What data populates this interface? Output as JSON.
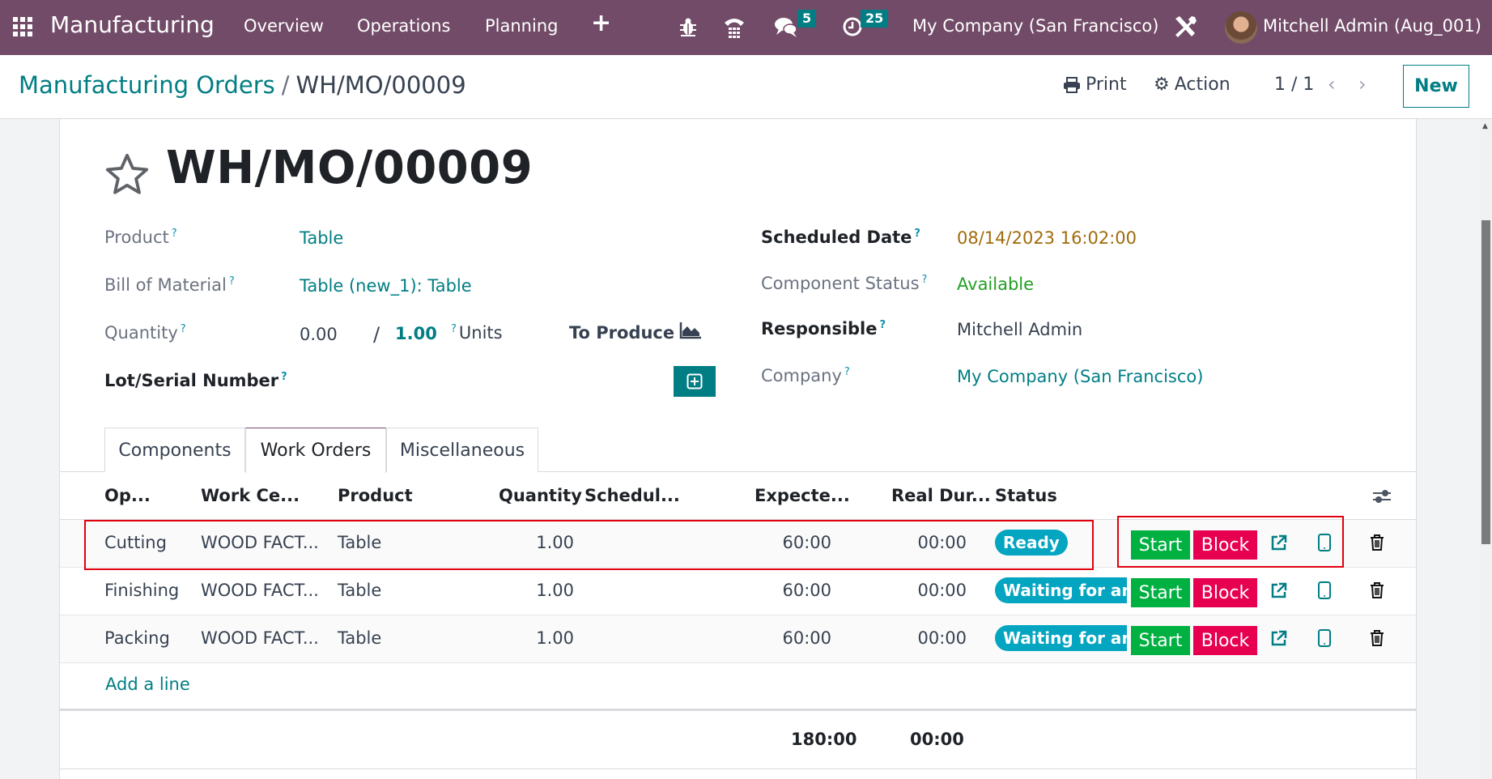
{
  "navbar": {
    "app_name": "Manufacturing",
    "menu": [
      "Overview",
      "Operations",
      "Planning"
    ],
    "messages_badge": "5",
    "activities_badge": "25",
    "company": "My Company (San Francisco)",
    "user": "Mitchell Admin (Aug_001)"
  },
  "control_panel": {
    "breadcrumb_parent": "Manufacturing Orders",
    "breadcrumb_sep": "/",
    "breadcrumb_current": "WH/MO/00009",
    "print_label": "Print",
    "action_label": "Action",
    "pager": "1 / 1",
    "new_label": "New"
  },
  "record": {
    "title": "WH/MO/00009",
    "fields_left": {
      "product_label": "Product",
      "product_value": "Table",
      "bom_label": "Bill of Material",
      "bom_value": "Table (new_1): Table",
      "quantity_label": "Quantity",
      "quantity_produced": "0.00",
      "quantity_sep": "/",
      "quantity_total": "1.00",
      "quantity_uom": "Units",
      "to_produce_label": "To Produce",
      "lot_label": "Lot/Serial Number"
    },
    "fields_right": {
      "scheduled_date_label": "Scheduled Date",
      "scheduled_date_value": "08/14/2023 16:02:00",
      "component_status_label": "Component Status",
      "component_status_value": "Available",
      "responsible_label": "Responsible",
      "responsible_value": "Mitchell Admin",
      "company_label": "Company",
      "company_value": "My Company (San Francisco)"
    },
    "help_mark": "?"
  },
  "tabs": [
    {
      "label": "Components",
      "active": false
    },
    {
      "label": "Work Orders",
      "active": true
    },
    {
      "label": "Miscellaneous",
      "active": false
    }
  ],
  "work_orders": {
    "columns": [
      "Op...",
      "Work Ce...",
      "Product",
      "Quantity",
      "Schedul...",
      "Expecte...",
      "Real Dur...",
      "Status"
    ],
    "rows": [
      {
        "operation": "Cutting",
        "work_center": "WOOD FACT...",
        "product": "Table",
        "quantity": "1.00",
        "scheduled": "",
        "expected": "60:00",
        "real": "00:00",
        "status": "Ready",
        "start_label": "Start",
        "block_label": "Block"
      },
      {
        "operation": "Finishing",
        "work_center": "WOOD FACT...",
        "product": "Table",
        "quantity": "1.00",
        "scheduled": "",
        "expected": "60:00",
        "real": "00:00",
        "status": "Waiting for another WO",
        "start_label": "Start",
        "block_label": "Block"
      },
      {
        "operation": "Packing",
        "work_center": "WOOD FACT...",
        "product": "Table",
        "quantity": "1.00",
        "scheduled": "",
        "expected": "60:00",
        "real": "00:00",
        "status": "Waiting for another WO",
        "start_label": "Start",
        "block_label": "Block"
      }
    ],
    "add_line_label": "Add a line",
    "total_expected": "180:00",
    "total_real": "00:00"
  },
  "colors": {
    "brand": "#714b67",
    "accent": "#017e84",
    "start": "#00b142",
    "block": "#e6004f",
    "status_badge": "#03a5c0",
    "highlight": "#e0000e"
  }
}
